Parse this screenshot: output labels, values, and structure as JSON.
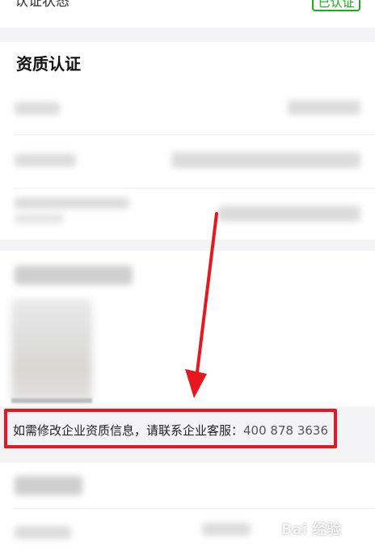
{
  "status": {
    "label": "认证状态",
    "badge": "已认证",
    "badge_color": "#1aad19"
  },
  "qualification": {
    "title": "资质认证",
    "notice_text": "如需修改企业资质信息，请联系企业客服：",
    "notice_phone": "400 878 3636"
  },
  "annotation": {
    "color": "#e8171f"
  },
  "watermark": {
    "text": "Bai 经验"
  }
}
